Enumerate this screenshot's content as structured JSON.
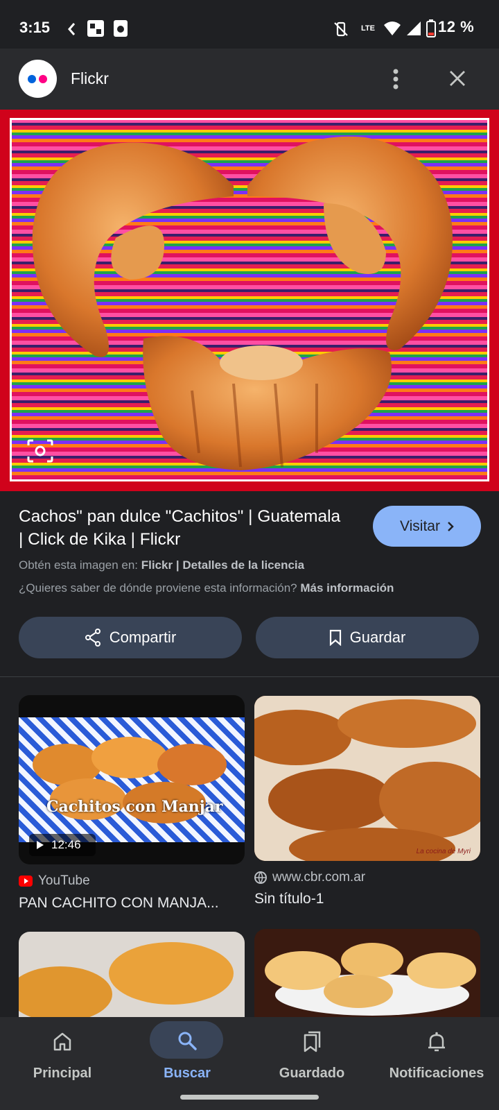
{
  "status_bar": {
    "time": "3:15",
    "battery": "12 %",
    "network": "LTE"
  },
  "header": {
    "title": "Flickr"
  },
  "result": {
    "title": "Cachos\" pan dulce \"Cachitos\" | Guatemala | Click de Kika | Flickr",
    "visit_label": "Visitar",
    "source_prefix": "Obtén esta imagen en:",
    "source_name": "Flickr",
    "source_sep": "|",
    "license_link": "Detalles de la licencia",
    "info_question": "¿Quieres saber de dónde proviene esta información?",
    "info_link": "Más información",
    "share_label": "Compartir",
    "save_label": "Guardar"
  },
  "related": [
    {
      "source": "YouTube",
      "title": "PAN CACHITO CON MANJA...",
      "duration": "12:46",
      "overlay_text": "Cachitos con Manjar"
    },
    {
      "source": "www.cbr.com.ar",
      "title": "Sin título-1",
      "watermark": "La cocina de Myri"
    }
  ],
  "nav": {
    "items": [
      {
        "label": "Principal",
        "icon": "home-icon"
      },
      {
        "label": "Buscar",
        "icon": "search-icon"
      },
      {
        "label": "Guardado",
        "icon": "bookmarks-icon"
      },
      {
        "label": "Notificaciones",
        "icon": "bell-icon"
      }
    ],
    "active": "Buscar"
  },
  "colors": {
    "accent": "#8ab4f8",
    "pill_bg": "#394457",
    "hero_border": "#d0021b",
    "background": "#1f2023"
  }
}
